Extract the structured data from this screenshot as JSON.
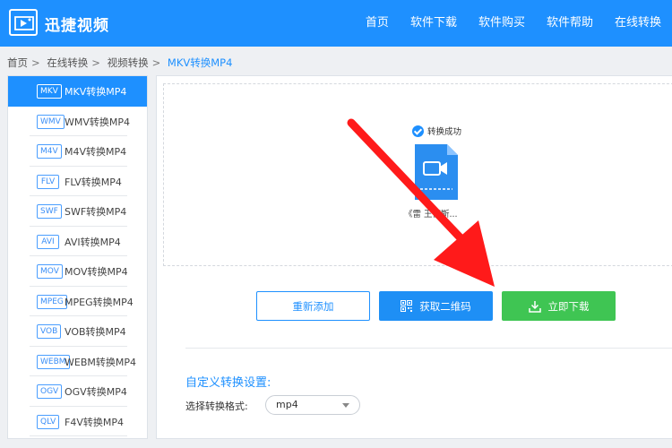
{
  "header": {
    "brand": "迅捷视频",
    "nav": [
      "首页",
      "软件下载",
      "软件购买",
      "软件帮助",
      "在线转换"
    ]
  },
  "breadcrumb": [
    "首页",
    "在线转换",
    "视频转换",
    "MKV转换MP4"
  ],
  "sidebar": {
    "items": [
      {
        "tag": "MKV",
        "label": "MKV转换MP4",
        "active": true
      },
      {
        "tag": "WMV",
        "label": "WMV转换MP4"
      },
      {
        "tag": "M4V",
        "label": "M4V转换MP4"
      },
      {
        "tag": "FLV",
        "label": "FLV转换MP4"
      },
      {
        "tag": "SWF",
        "label": "SWF转换MP4"
      },
      {
        "tag": "AVI",
        "label": "AVI转换MP4"
      },
      {
        "tag": "MOV",
        "label": "MOV转换MP4"
      },
      {
        "tag": "MPEG",
        "label": "MPEG转换MP4"
      },
      {
        "tag": "VOB",
        "label": "VOB转换MP4"
      },
      {
        "tag": "WEBM",
        "label": "WEBM转换MP4"
      },
      {
        "tag": "OGV",
        "label": "OGV转换MP4"
      },
      {
        "tag": "QLV",
        "label": "F4V转换MP4"
      }
    ]
  },
  "main": {
    "status": "转换成功",
    "file_name": "《雷 王衡斯...",
    "buttons": {
      "readd": "重新添加",
      "qr": "获取二维码",
      "download": "立即下载"
    },
    "settings_title": "自定义转换设置:",
    "format_label": "选择转换格式:",
    "format_value": "mp4"
  },
  "colors": {
    "primary": "#1e90ff",
    "download": "#3fc553",
    "annotation_arrow": "#ff1a1a"
  },
  "icons": [
    "video-logo-icon",
    "check-circle-icon",
    "video-file-icon",
    "qr-code-icon",
    "download-icon",
    "chevron-down-icon"
  ]
}
